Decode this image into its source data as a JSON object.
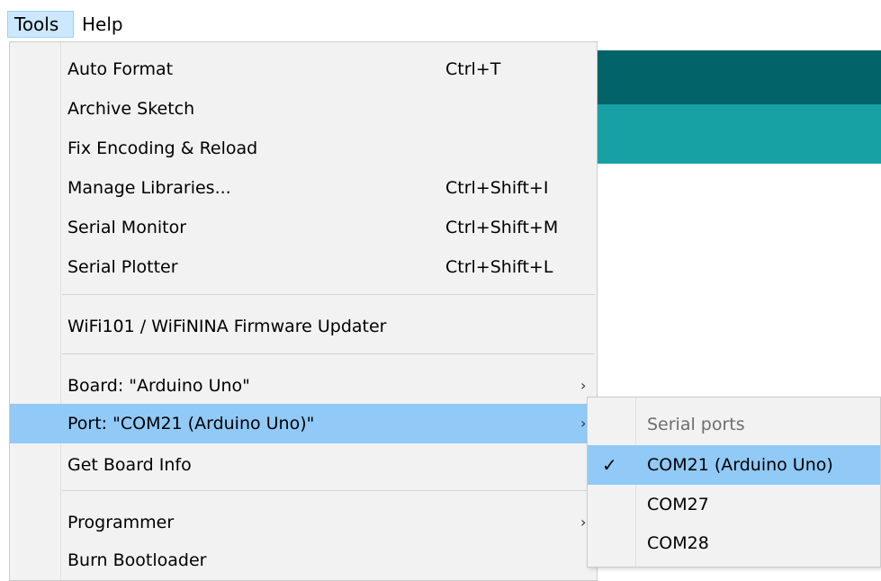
{
  "menubar": {
    "tools": "Tools",
    "help": "Help"
  },
  "menu": {
    "items": [
      {
        "label": "Auto Format",
        "shortcut": "Ctrl+T"
      },
      {
        "label": "Archive Sketch",
        "shortcut": ""
      },
      {
        "label": "Fix Encoding & Reload",
        "shortcut": ""
      },
      {
        "label": "Manage Libraries...",
        "shortcut": "Ctrl+Shift+I"
      },
      {
        "label": "Serial Monitor",
        "shortcut": "Ctrl+Shift+M"
      },
      {
        "label": "Serial Plotter",
        "shortcut": "Ctrl+Shift+L"
      },
      {
        "label": "WiFi101 / WiFiNINA Firmware Updater",
        "shortcut": ""
      },
      {
        "label": "Board: \"Arduino Uno\"",
        "shortcut": ""
      },
      {
        "label": "Port: \"COM21 (Arduino Uno)\"",
        "shortcut": ""
      },
      {
        "label": "Get Board Info",
        "shortcut": ""
      },
      {
        "label": "Programmer",
        "shortcut": ""
      },
      {
        "label": "Burn Bootloader",
        "shortcut": ""
      }
    ],
    "submenu_arrow": "›"
  },
  "port_submenu": {
    "header": "Serial ports",
    "items": [
      {
        "label": "COM21 (Arduino Uno)",
        "checked": true
      },
      {
        "label": "COM27",
        "checked": false
      },
      {
        "label": "COM28",
        "checked": false
      }
    ],
    "check_glyph": "✓"
  },
  "colors": {
    "header_dark": "#006468",
    "header_light": "#17a1a5",
    "highlight": "#91c9f7",
    "menu_bg": "#f2f2f2"
  }
}
